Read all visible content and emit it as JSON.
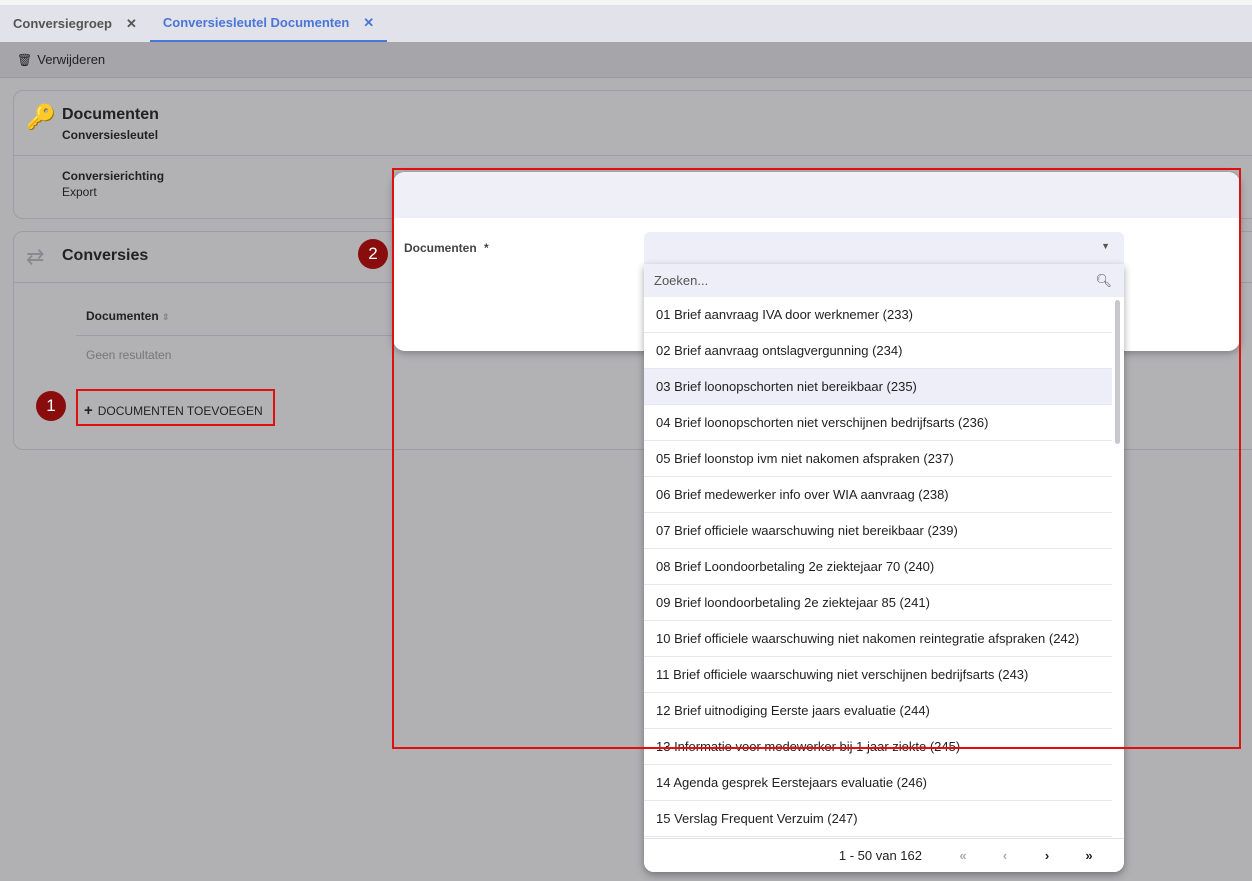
{
  "tabs": [
    {
      "label": "Conversiegroep",
      "active": false
    },
    {
      "label": "Conversiesleutel Documenten",
      "active": true
    }
  ],
  "toolbar": {
    "delete_label": "Verwijderen"
  },
  "header_card": {
    "title": "Documenten",
    "subtitle": "Conversiesleutel",
    "field_label": "Conversierichting",
    "field_value": "Export"
  },
  "conversies": {
    "title": "Conversies",
    "column": "Documenten",
    "empty": "Geen resultaten",
    "add_button": "DOCUMENTEN TOEVOEGEN"
  },
  "badges": [
    "1",
    "2"
  ],
  "modal": {
    "field_label": "Documenten",
    "required": "*",
    "search_placeholder": "Zoeken...",
    "options": [
      "01 Brief aanvraag IVA door werknemer (233)",
      "02 Brief aanvraag ontslagvergunning (234)",
      "03 Brief loonopschorten niet bereikbaar (235)",
      "04 Brief loonopschorten niet verschijnen bedrijfsarts (236)",
      "05 Brief loonstop ivm niet nakomen afspraken (237)",
      "06 Brief medewerker info over WIA aanvraag (238)",
      "07 Brief officiele waarschuwing niet bereikbaar (239)",
      "08 Brief Loondoorbetaling 2e ziektejaar 70 (240)",
      "09 Brief loondoorbetaling 2e ziektejaar 85 (241)",
      "10 Brief officiele waarschuwing niet nakomen reintegratie afspraken (242)",
      "11 Brief officiele waarschuwing niet verschijnen bedrijfsarts (243)",
      "12 Brief uitnodiging Eerste jaars evaluatie (244)",
      "13 Informatie voor medewerker bij 1 jaar ziekte (245)",
      "14 Agenda gesprek Eerstejaars evaluatie (246)",
      "15 Verslag Frequent Verzuim (247)"
    ],
    "highlighted_index": 2,
    "pager": "1 - 50 van 162"
  },
  "colors": {
    "accent": "#4a76d8",
    "badge": "#8a0d0d",
    "annotation": "#e01010"
  }
}
